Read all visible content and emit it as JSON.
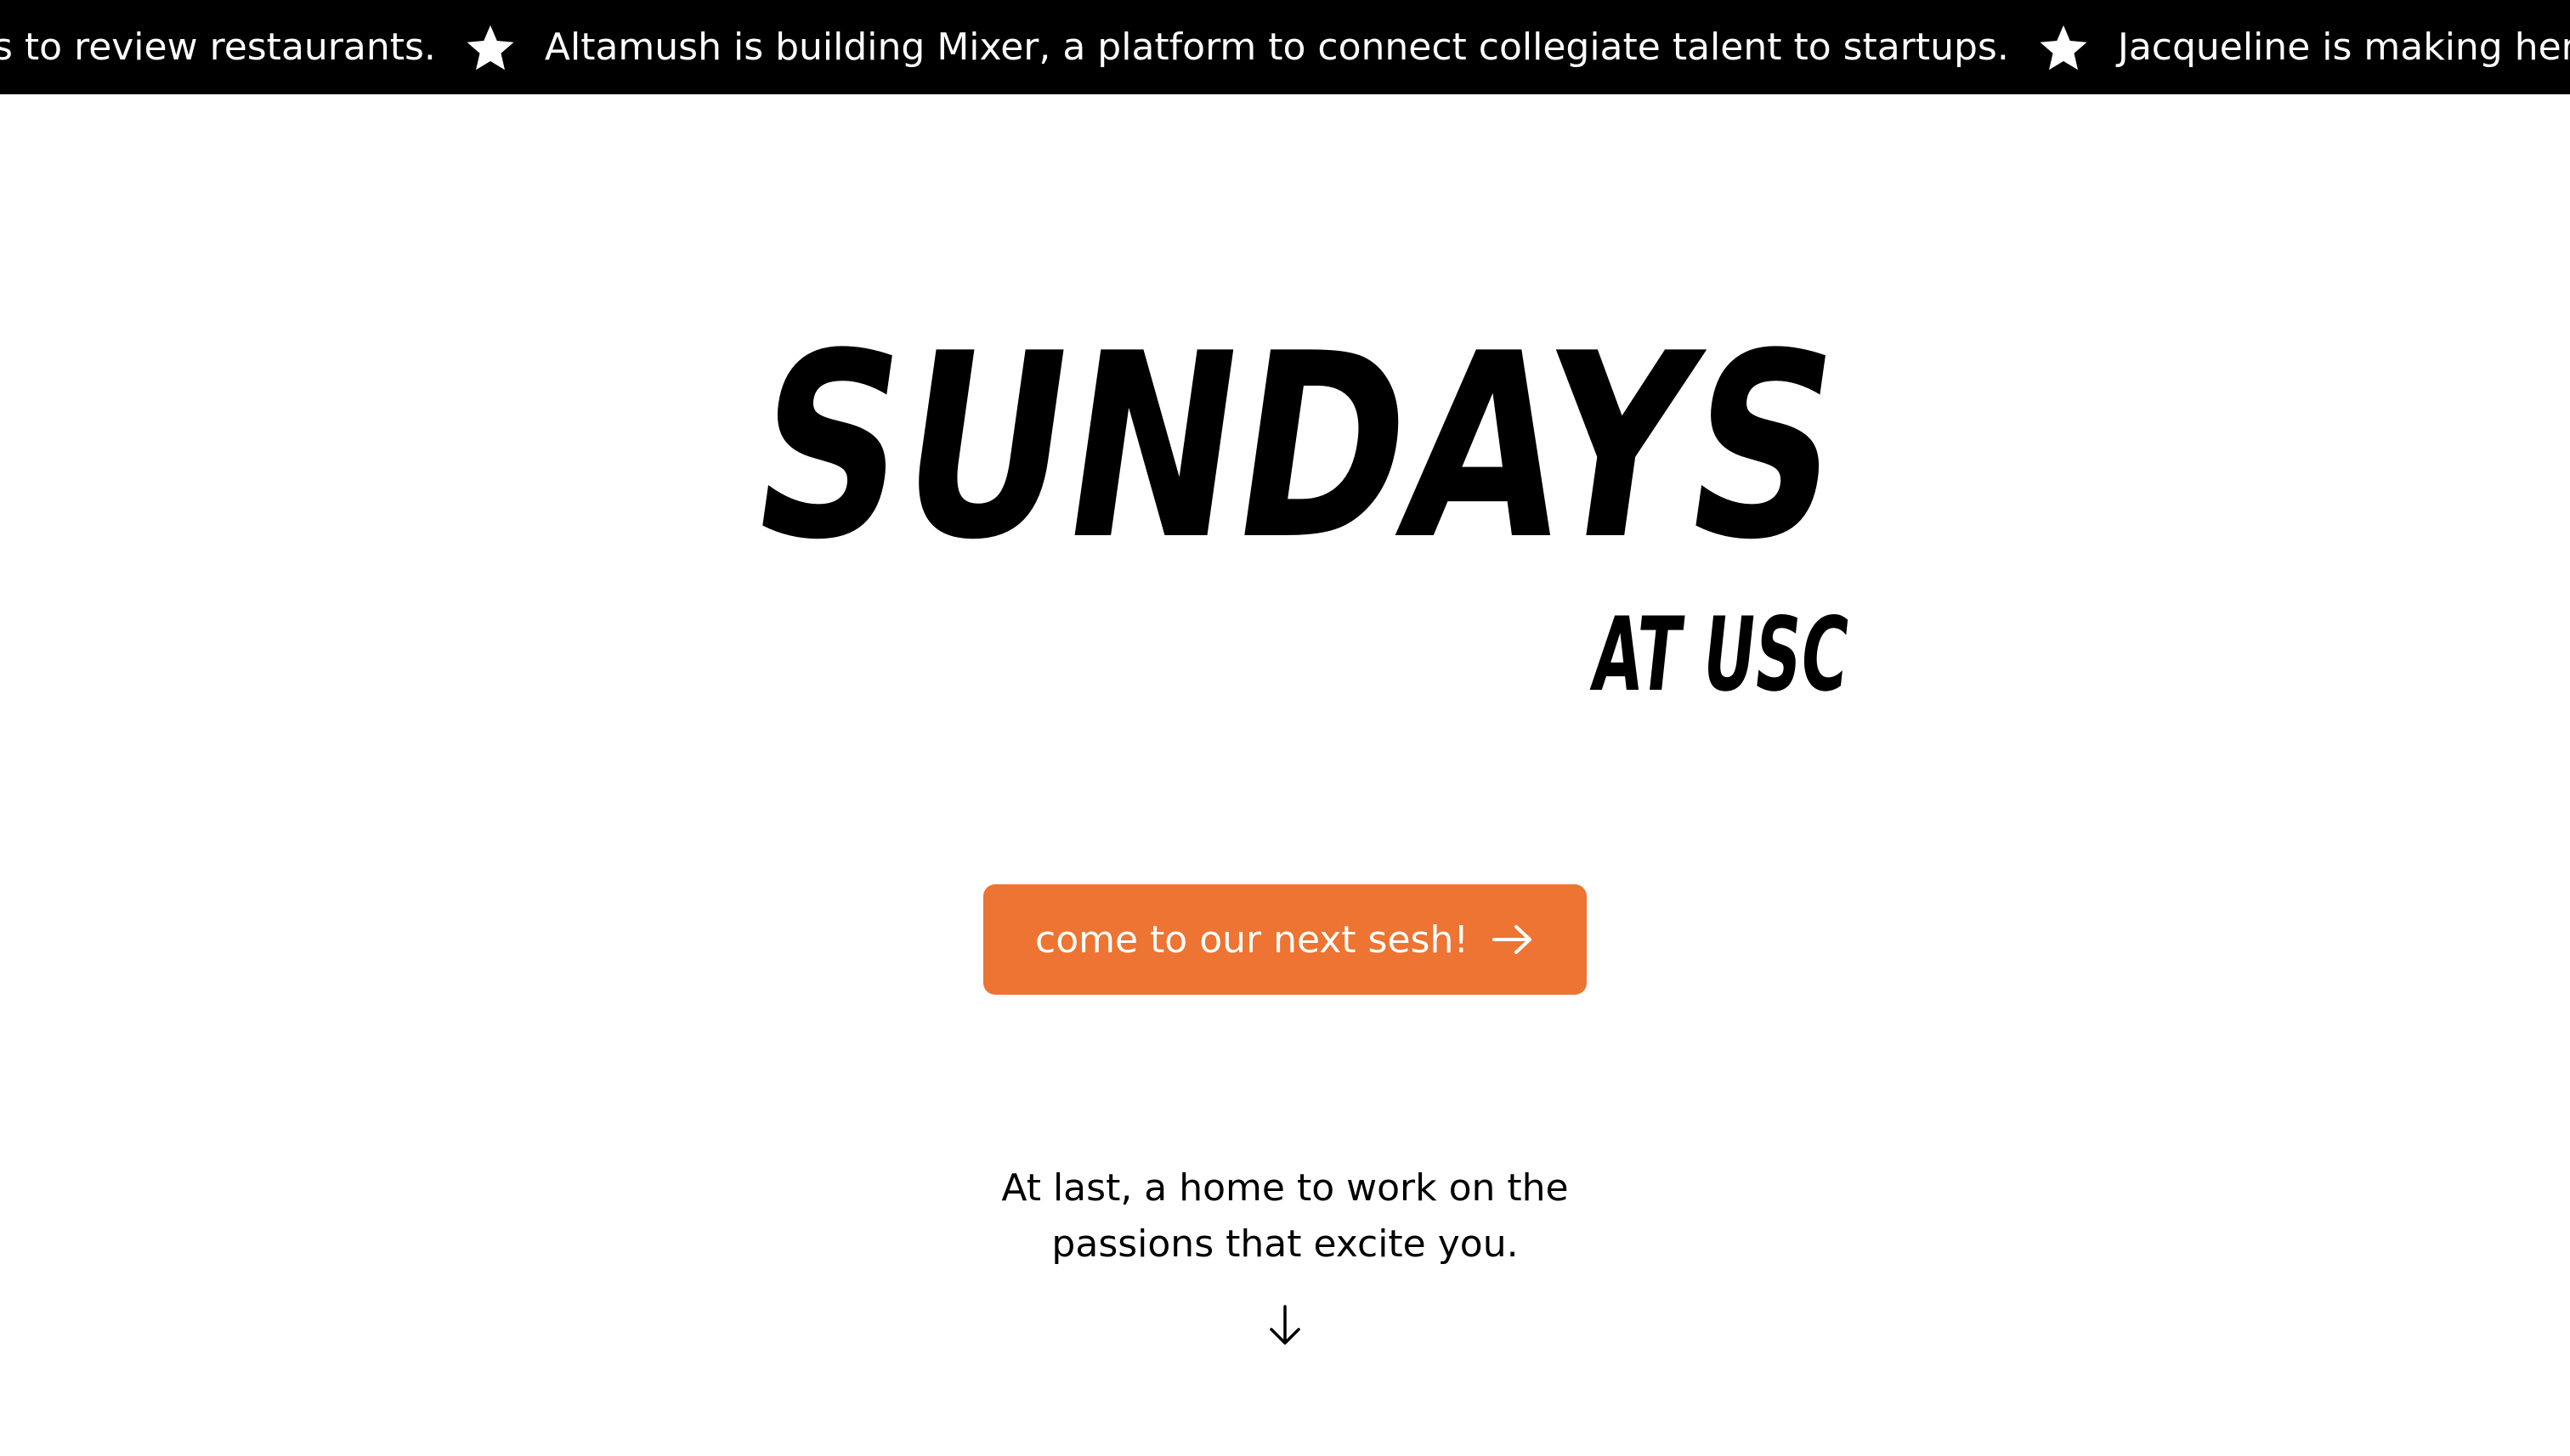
{
  "ticker": {
    "items": [
      "s to review restaurants.",
      "Altamush is building Mixer, a platform to connect collegiate talent to startups.",
      "Jacqueline is making her first"
    ],
    "star_icon": "star-icon",
    "background": "#000000",
    "text_color": "#ffffff"
  },
  "hero": {
    "title": "SUNDAYS",
    "subtitle": "AT USC"
  },
  "cta": {
    "label": "come to our next sesh!",
    "icon": "arrow-right-icon",
    "color": "#ed7432"
  },
  "tagline": {
    "line1": "At last, a home to work on the",
    "line2": "passions that excite you."
  },
  "scroll": {
    "icon": "arrow-down-icon"
  }
}
